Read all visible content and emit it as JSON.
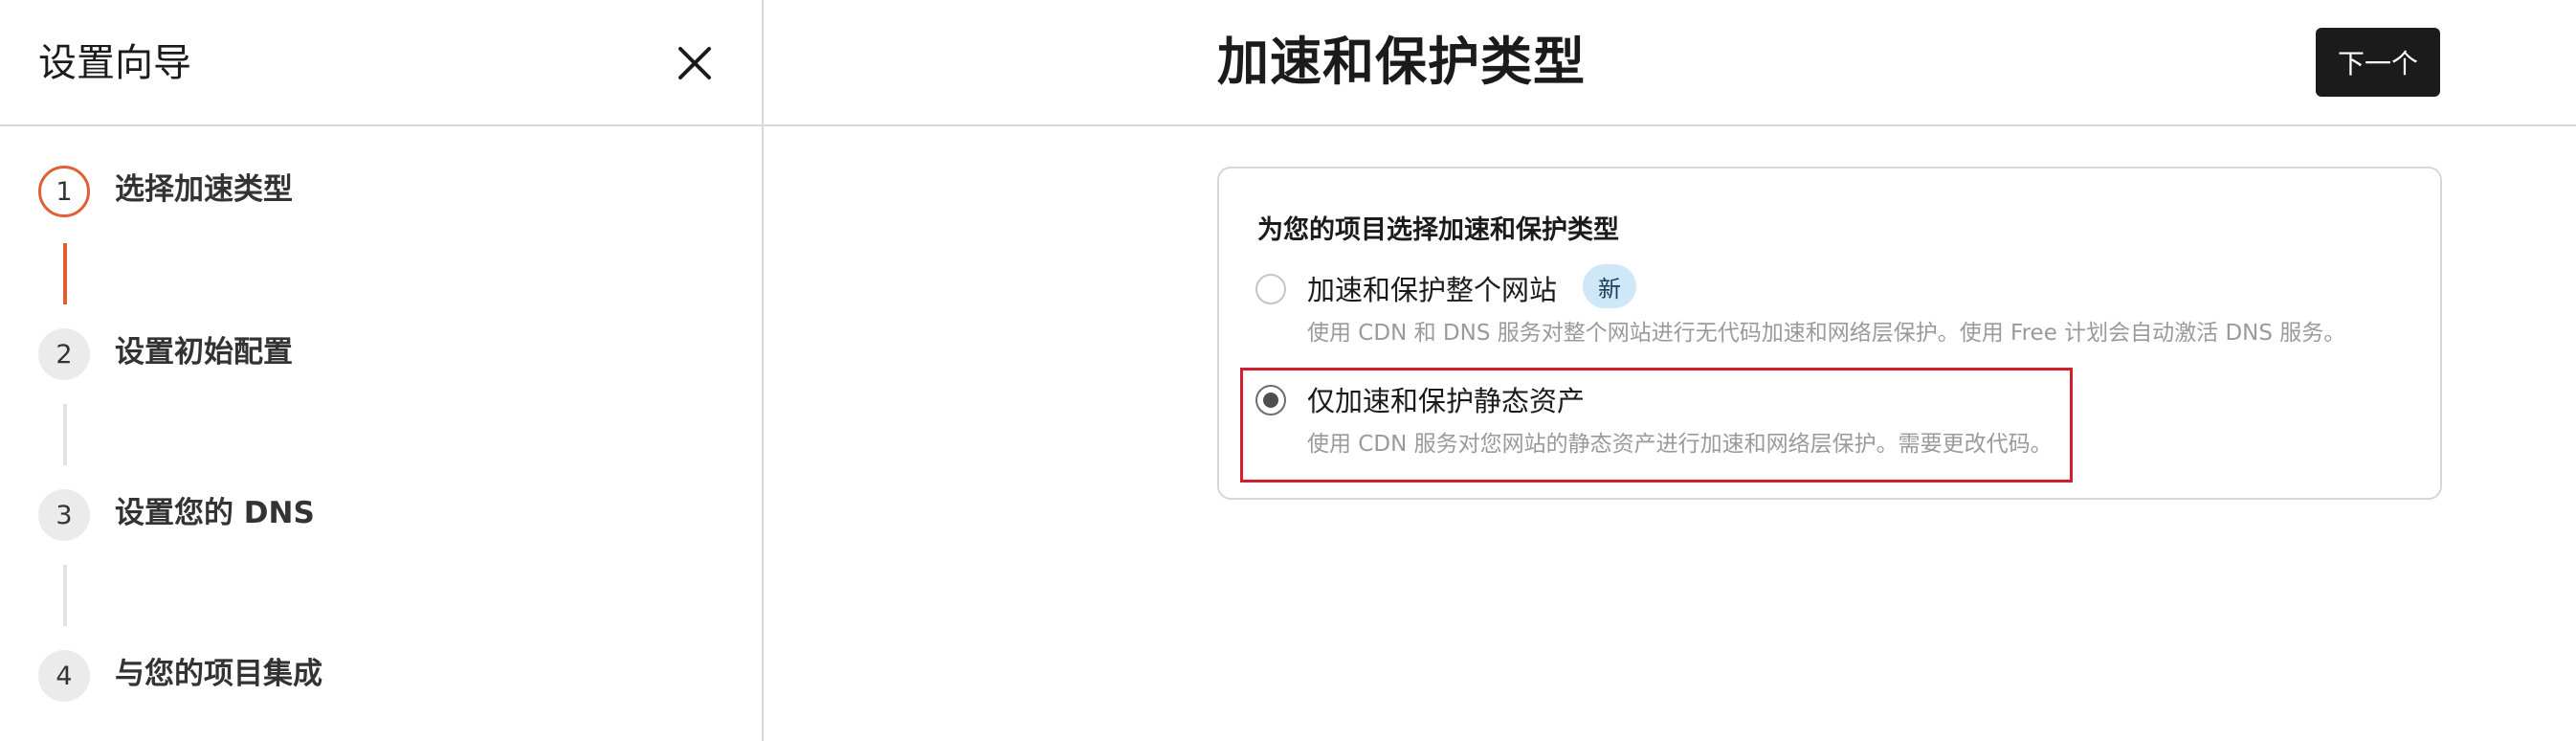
{
  "sidebar": {
    "title": "设置向导",
    "steps": [
      {
        "number": "1",
        "label": "选择加速类型",
        "state": "active"
      },
      {
        "number": "2",
        "label": "设置初始配置",
        "state": "pending"
      },
      {
        "number": "3",
        "label": "设置您的 DNS",
        "state": "pending"
      },
      {
        "number": "4",
        "label": "与您的项目集成",
        "state": "pending"
      }
    ]
  },
  "header": {
    "title": "加速和保护类型",
    "next_label": "下一个"
  },
  "card": {
    "heading": "为您的项目选择加速和保护类型",
    "options": [
      {
        "label": "加速和保护整个网站",
        "badge": "新",
        "description": "使用 CDN 和 DNS 服务对整个网站进行无代码加速和网络层保护。使用 Free 计划会自动激活 DNS 服务。",
        "selected": false
      },
      {
        "label": "仅加速和保护静态资产",
        "description": "使用 CDN 服务对您网站的静态资产进行加速和网络层保护。需要更改代码。",
        "selected": true
      }
    ]
  },
  "colors": {
    "accent": "#e05f35",
    "highlight_border": "#d3202f",
    "button_bg": "#1b1b1b",
    "badge_bg": "#cfe8f8"
  }
}
